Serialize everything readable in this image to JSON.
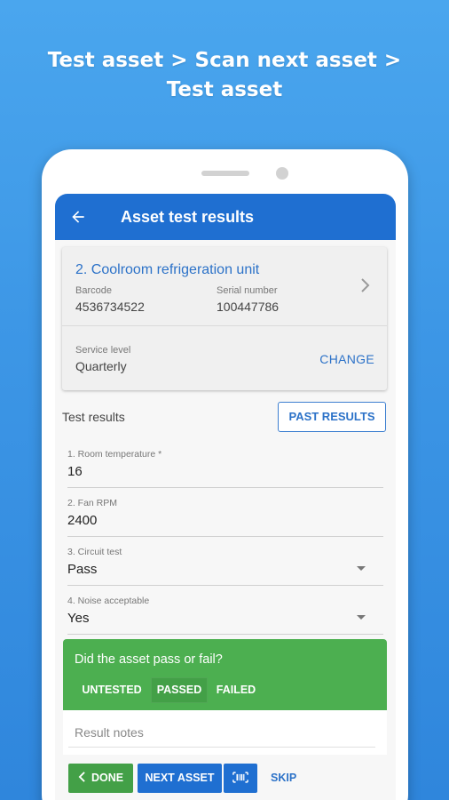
{
  "headline": {
    "line1": "Test asset > Scan next asset >",
    "line2": "Test asset"
  },
  "appbar": {
    "title": "Asset test results",
    "back_icon": "arrow-left-icon"
  },
  "asset": {
    "title": "2. Coolroom refrigeration unit",
    "barcode_label": "Barcode",
    "barcode_value": "4536734522",
    "serial_label": "Serial number",
    "serial_value": "100447786",
    "service_label": "Service level",
    "service_value": "Quarterly",
    "change_label": "CHANGE"
  },
  "test_results": {
    "section_label": "Test results",
    "past_results_label": "PAST RESULTS",
    "fields": [
      {
        "label": "1. Room temperature *",
        "value": "16"
      },
      {
        "label": "2. Fan RPM",
        "value": "2400"
      },
      {
        "label": "3. Circuit test",
        "value": "Pass"
      },
      {
        "label": "4. Noise acceptable",
        "value": "Yes"
      }
    ]
  },
  "pass_fail": {
    "question": "Did the asset pass or fail?",
    "options": [
      "UNTESTED",
      "PASSED",
      "FAILED"
    ],
    "selected": "PASSED"
  },
  "notes": {
    "placeholder": "Result notes"
  },
  "actions": {
    "done_label": "DONE",
    "next_asset_label": "NEXT ASSET",
    "scan_icon": "barcode-scan-icon",
    "skip_label": "SKIP"
  },
  "colors": {
    "background": "#3d97e6",
    "appbar": "#1f6fd1",
    "accent": "#2c72c8",
    "pass_green": "#4caf50"
  }
}
